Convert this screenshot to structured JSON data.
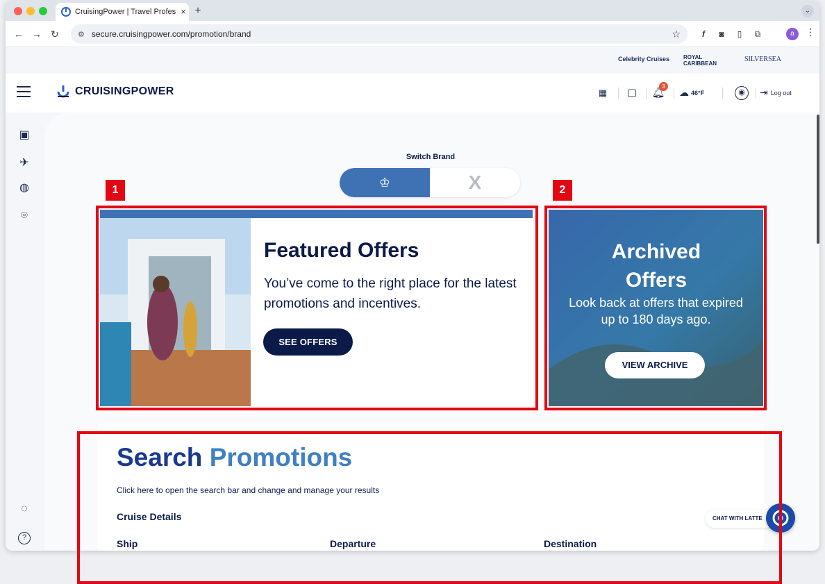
{
  "window": {
    "tab": {
      "title": "CruisingPower | Travel Profes",
      "close": "×"
    },
    "new_tab": "+",
    "tab_menu": "⌄",
    "nav": {
      "back": "←",
      "forward": "→",
      "reload": "↻"
    },
    "url": "secure.cruisingpower.com/promotion/brand",
    "profile_initial": "a",
    "colors": {
      "close": "#ff5f57",
      "minimize": "#febc2e",
      "maximize": "#28c840"
    }
  },
  "app": {
    "brands": [
      "Celebrity Cruises",
      "ROYAL CARIBBEAN",
      "SILVERSEA"
    ],
    "logo_text": "CRUISINGPOWER",
    "notifications_count": "3",
    "weather": "46°F",
    "logout_label": "Log out",
    "switch_brand_label": "Switch Brand",
    "featured": {
      "title": "Featured Offers",
      "text": "You’ve come to the right place for the latest promotions and incentives.",
      "button": "SEE OFFERS"
    },
    "archived": {
      "title": "Archived Offers",
      "text": "Look back at offers that expired up to 180 days ago.",
      "button": "VIEW ARCHIVE"
    },
    "search": {
      "title_part1": "Search",
      "title_part2": "Promotions",
      "hint": "Click here to open the search bar and change and manage your results",
      "section": "Cruise Details",
      "fields": [
        "Ship",
        "Departure",
        "Destination"
      ]
    },
    "chat_label": "CHAT WITH LATTE",
    "colors": {
      "brand_blue": "#3f72b5",
      "navy": "#0c1a4a",
      "annotation": "#e30613"
    }
  },
  "annotations": [
    "1",
    "2"
  ]
}
